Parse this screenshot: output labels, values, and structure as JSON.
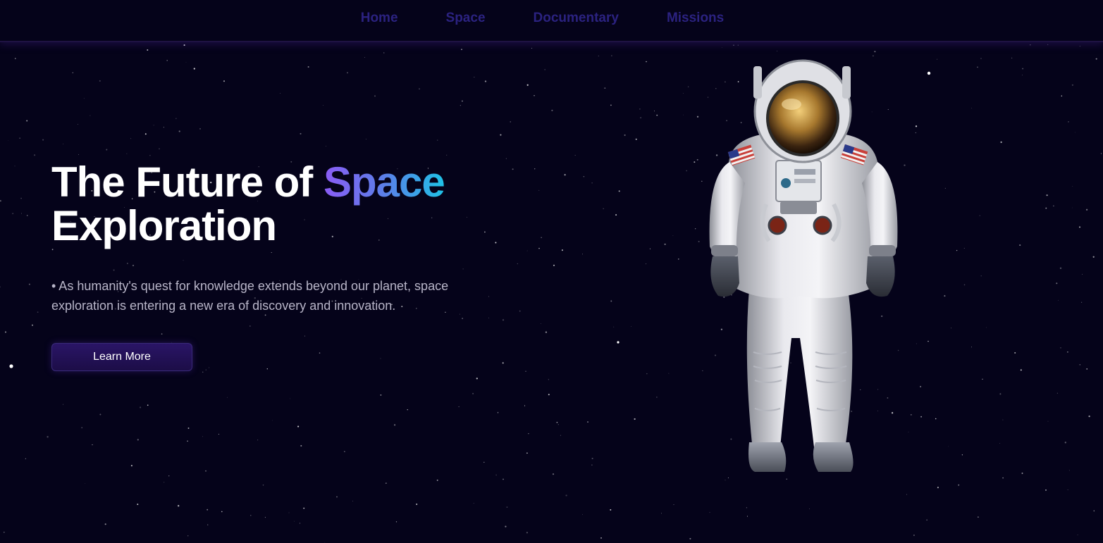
{
  "nav": {
    "items": [
      {
        "label": "Home"
      },
      {
        "label": "Space"
      },
      {
        "label": "Documentary"
      },
      {
        "label": "Missions"
      }
    ]
  },
  "hero": {
    "title_part1": "The Future of ",
    "title_accent": "Space",
    "title_part2": "Exploration",
    "description": "• As humanity's quest for knowledge extends beyond our planet, space exploration is entering a new era of discovery and innovation.",
    "button_label": "Learn More"
  },
  "colors": {
    "background": "#05031a",
    "nav_link": "#2b2280",
    "accent_gradient_start": "#8b5cf6",
    "accent_gradient_end": "#1fc2e6",
    "button": "#24125a"
  }
}
